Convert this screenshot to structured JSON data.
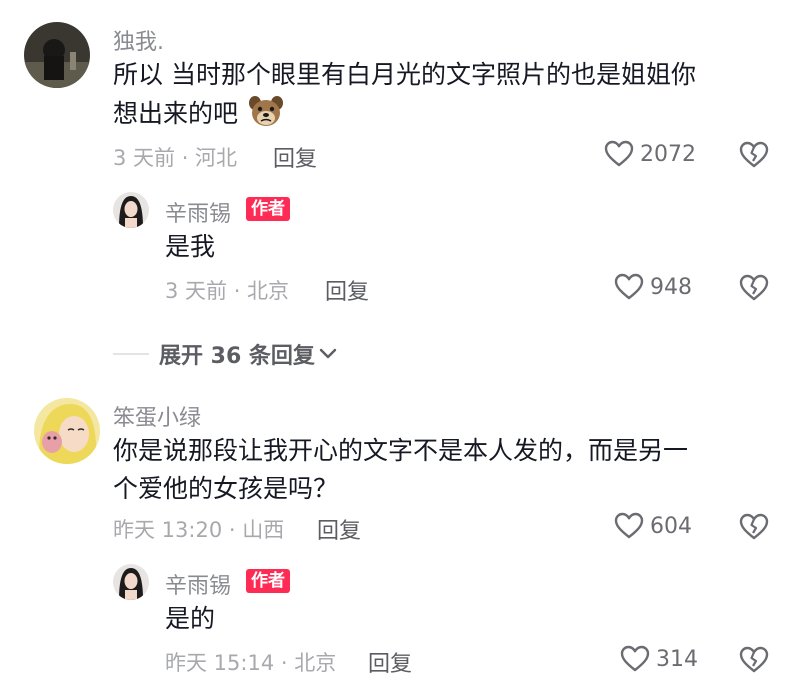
{
  "comments": [
    {
      "username": "独我.",
      "text_line1": "所以 当时那个眼里有白月光的文字照片的也是姐姐你",
      "text_line2": "想出来的吧",
      "emoji": "dog-face-emoji",
      "time_location": "3 天前 · 河北",
      "reply_label": "回复",
      "likes": "2072",
      "replies": [
        {
          "username": "辛雨锡",
          "badge": "作者",
          "text": "是我",
          "time_location": "3 天前 · 北京",
          "reply_label": "回复",
          "likes": "948"
        }
      ],
      "expand_label": "展开 36 条回复"
    },
    {
      "username": "笨蛋小绿",
      "text_line1": "你是说那段让我开心的文字不是本人发的，而是另一",
      "text_line2": "个爱他的女孩是吗？",
      "time_location": "昨天 13:20 · 山西",
      "reply_label": "回复",
      "likes": "604",
      "replies": [
        {
          "username": "辛雨锡",
          "badge": "作者",
          "text": "是的",
          "time_location": "昨天 15:14 · 北京",
          "reply_label": "回复",
          "likes": "314"
        }
      ]
    }
  ],
  "colors": {
    "badge": "#fe2c55",
    "text": "#161823",
    "meta": "#a8a9ad"
  },
  "icons": {
    "like": "heart-outline-icon",
    "dislike": "broken-heart-icon",
    "expand": "chevron-down-icon"
  }
}
